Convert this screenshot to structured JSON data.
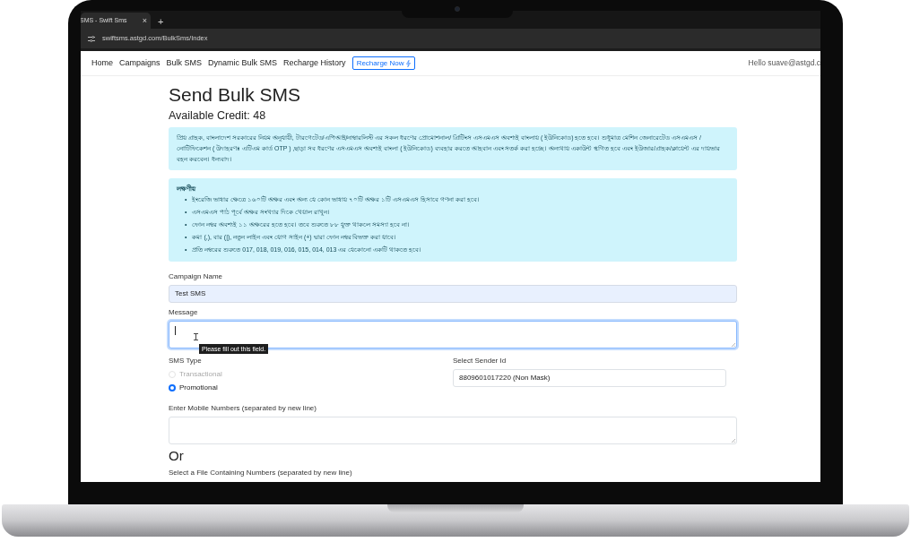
{
  "browser": {
    "tab_title": "SMS - Swift Sms",
    "tab_close": "×",
    "new_tab": "+",
    "url": "swiftsms.astgd.com/BulkSms/Index"
  },
  "navbar": {
    "links": [
      {
        "label": "Home"
      },
      {
        "label": "Campaigns"
      },
      {
        "label": "Bulk SMS"
      },
      {
        "label": "Dynamic Bulk SMS"
      },
      {
        "label": "Recharge History"
      }
    ],
    "cta": "Recharge Now",
    "greeting": "Hello suave@astgd.c"
  },
  "page": {
    "title": "Send Bulk SMS",
    "credit": "Available Credit: 48"
  },
  "notice": "প্রিয় গ্রাহক, বাংলাদেশ সরকারের নিয়ম অনুযায়ী, টারগেটেড/এপিআই/নাম্বারলিস্ট এর সকল ধরণের প্রোমোশনাল/ গ্রিটিংস এসএমএস অবশ্যই বাংলায় ( ইউনিকোড) হতে হবে। শুধুমাত্র মেশিন জেনারেটেড এসএমএস / নোটিফিকেশন ( উদাহরণঃ এটিএম কার্ড OTP ) ,ছাড়া সব ধরণের এসএমএস অবশ্যই বাংলা ( ইউনিকোড) ব্যবহার করতে আহবান এবং সতর্ক করা হচ্ছে। অন্যথায় একাউন্ট স্থগিত হবে এবং ইউজার/গ্রাহক/ক্লায়েন্ট এর দায়ভার বহন করবেন। ধন্যবাদ।",
  "notes": {
    "heading": "লক্ষণীয়",
    "bullet": "•",
    "items": [
      "ইংরেজি ভাষার ক্ষেত্রে ১৬০টি অক্ষর এবং অন্য যে কোন ভাষায় ৭০টি অক্ষর ১টি এসএমএস হিসাবে গণনা করা হবে।",
      "এসএমএস পাঠ পূর্বে অক্ষর সংখ্যার দিকে খেয়াল রাখুন।",
      "ফোন নম্বর অবশ্যই ১১ অক্ষরের হতে হবে। তবে শুরুতে ৮৮ যুক্ত থাকলে সমস্যা হবে না।",
      "কমা (,), বার (|), নতুন লাইন এবং যোগ সাইন (+) দ্বারা ফোন নম্বর বিভক্ত করা যাবে।",
      "প্রতি নম্বরের শুরুতে 017, 018, 019, 016, 015, 014, 013 এর যেকোনো একটি থাকতে হবে।"
    ]
  },
  "form": {
    "campaign_name": {
      "label": "Campaign Name",
      "value": "Test SMS",
      "autofilled": true
    },
    "message": {
      "label": "Message",
      "focused": true,
      "tooltip": "Please fill out this field."
    },
    "sms_type": {
      "label": "SMS Type",
      "options": [
        {
          "label": "Transactional",
          "selected": false,
          "disabled": true
        },
        {
          "label": "Promotional",
          "selected": true,
          "disabled": false
        }
      ]
    },
    "sender": {
      "label": "Select Sender Id",
      "value": "8809601017220 (Non Mask)"
    },
    "numbers": {
      "label": "Enter Mobile Numbers (separated by new line)"
    },
    "or": "Or",
    "file": {
      "label": "Select a File Containing Numbers (separated by new line)"
    }
  }
}
